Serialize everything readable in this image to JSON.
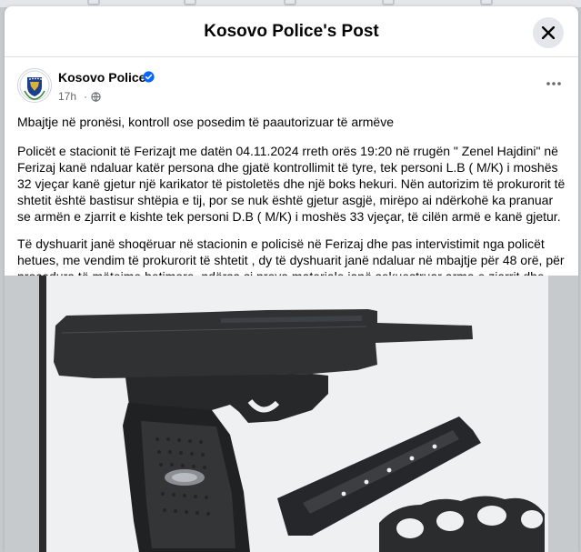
{
  "modal": {
    "title": "Kosovo Police's Post",
    "close_icon": "close-icon"
  },
  "author": {
    "name": "Kosovo Police",
    "time": "17h",
    "separator": "·",
    "verified_icon": "verified-badge-icon",
    "audience_icon": "globe-icon",
    "more_icon": "more-options-icon"
  },
  "post": {
    "paragraphs": [
      "Mbajtje në pronësi, kontroll ose posedim të paautorizuar të armëve",
      "Policët e stacionit të Ferizajt me datën 04.11.2024 rreth orës 19:20 në rrugën \" Zenel Hajdini\" në Ferizaj kanë ndaluar katër persona dhe gjatë kontrollimit të tyre, tek personi L.B ( M/K) i moshës 32 vjeçar kanë gjetur një karikator të pistoletës dhe një boks hekuri. Nën autorizim të prokurorit të shtetit është bastisur shtëpia e tij, por se nuk është gjetur asgjë, mirëpo ai ndërkohë ka pranuar se armën e zjarrit e kishte tek personi D.B ( M/K) i moshës 33 vjeçar, të cilën armë e kanë gjetur.",
      "Të dyshuarit janë shoqëruar në stacionin e policisë në Ferizaj dhe pas intervistimit nga policët hetues, me vendim të prokurorit të shtetit , dy të dyshuarit janë ndaluar në mbajtje për 48 orë, për procedura të mëtejme hetimore, ndërsa si prova materiale janë sekuestruar arma e zjarrit dhe boksi i hekurit."
    ]
  },
  "photo": {
    "description_icon": "seized-pistol-magazine-brass-knuckles-photo"
  },
  "colors": {
    "accent_blue": "#0866ff",
    "secondary_text": "#65676b",
    "backdrop": "#c7cacd"
  }
}
